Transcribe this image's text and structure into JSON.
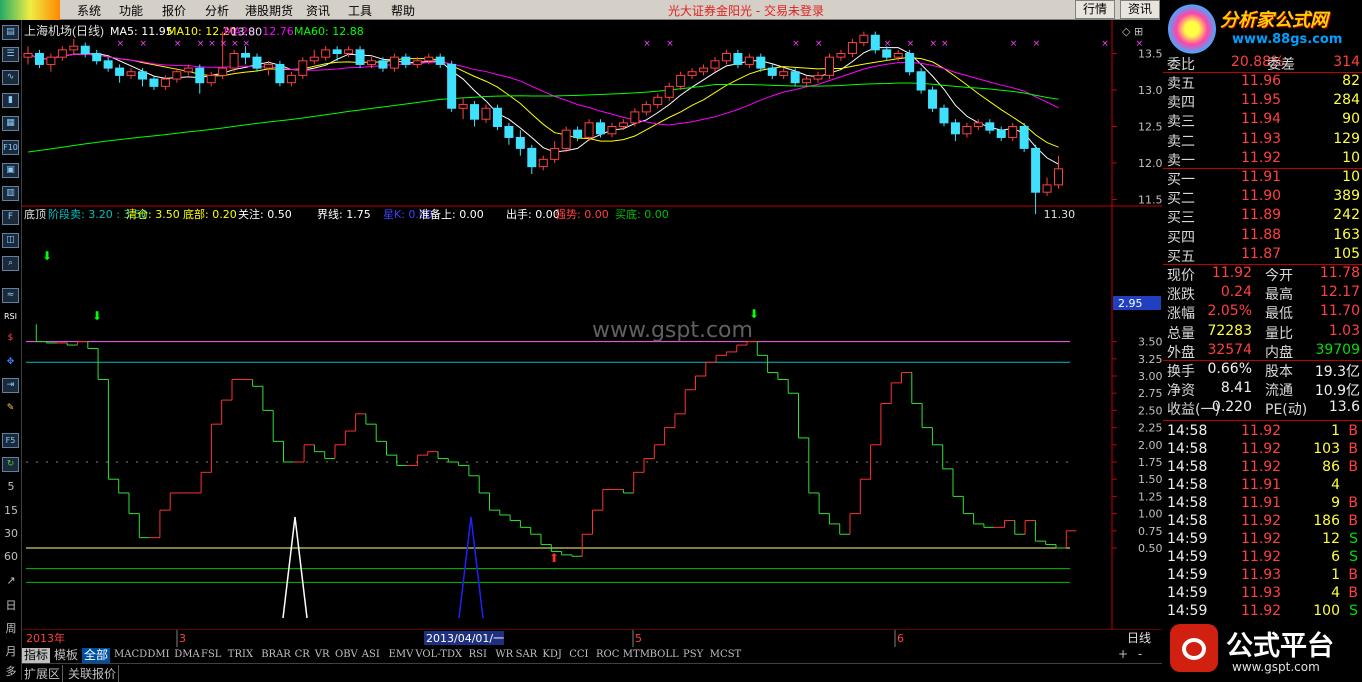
{
  "app": {
    "broker_notice": "光大证券金阳光 - 交易未登录"
  },
  "menu": [
    "系统",
    "功能",
    "报价",
    "分析",
    "港股期货",
    "资讯",
    "工具",
    "帮助"
  ],
  "top_buttons": [
    "行情",
    "资讯"
  ],
  "brand": {
    "name": "分析家公式网",
    "url": "www.88gs.com"
  },
  "brand2": {
    "name": "公式平台",
    "url": "www.gspt.com"
  },
  "watermark": "www.gspt.com",
  "toolbar_numbers": [
    "5",
    "15",
    "30",
    "60"
  ],
  "toolbar_labels": [
    "F10",
    "RSI",
    "F5",
    "日",
    "周",
    "月",
    "多"
  ],
  "main_chart": {
    "title": "上海机场(日线)",
    "ma": [
      {
        "label": "MA5: 11.95",
        "color": "#ffffff"
      },
      {
        "label": "MA10: 12.20",
        "color": "#ffff00"
      },
      {
        "label": "MA20: 12.76",
        "color": "#ff00ff"
      },
      {
        "label": "MA60: 12.88",
        "color": "#00ff00"
      }
    ],
    "high_label": "13.80",
    "low_label": "11.30",
    "yticks": [
      "13.50",
      "13.00",
      "12.50",
      "12.00",
      "11.50"
    ],
    "candles": [
      [
        13.45,
        13.5,
        13.6,
        13.35
      ],
      [
        13.5,
        13.35,
        13.55,
        13.3
      ],
      [
        13.35,
        13.45,
        13.5,
        13.25
      ],
      [
        13.45,
        13.55,
        13.6,
        13.4
      ],
      [
        13.55,
        13.6,
        13.7,
        13.5
      ],
      [
        13.6,
        13.5,
        13.65,
        13.45
      ],
      [
        13.5,
        13.4,
        13.55,
        13.35
      ],
      [
        13.4,
        13.3,
        13.45,
        13.25
      ],
      [
        13.3,
        13.2,
        13.35,
        13.1
      ],
      [
        13.2,
        13.25,
        13.3,
        13.15
      ],
      [
        13.25,
        13.15,
        13.3,
        13.05
      ],
      [
        13.15,
        13.05,
        13.2,
        13.0
      ],
      [
        13.05,
        13.15,
        13.2,
        13.0
      ],
      [
        13.15,
        13.25,
        13.3,
        13.1
      ],
      [
        13.25,
        13.3,
        13.35,
        13.2
      ],
      [
        13.3,
        13.1,
        13.35,
        12.95
      ],
      [
        13.1,
        13.2,
        13.25,
        13.05
      ],
      [
        13.2,
        13.3,
        13.8,
        13.15
      ],
      [
        13.3,
        13.5,
        13.55,
        13.25
      ],
      [
        13.5,
        13.45,
        13.6,
        13.35
      ],
      [
        13.45,
        13.3,
        13.5,
        13.25
      ],
      [
        13.3,
        13.35,
        13.4,
        13.2
      ],
      [
        13.35,
        13.1,
        13.4,
        13.05
      ],
      [
        13.1,
        13.2,
        13.25,
        13.05
      ],
      [
        13.2,
        13.4,
        13.45,
        13.15
      ],
      [
        13.4,
        13.45,
        13.55,
        13.35
      ],
      [
        13.45,
        13.55,
        13.6,
        13.4
      ],
      [
        13.55,
        13.5,
        13.6,
        13.4
      ],
      [
        13.5,
        13.55,
        13.6,
        13.45
      ],
      [
        13.55,
        13.35,
        13.6,
        13.3
      ],
      [
        13.35,
        13.4,
        13.45,
        13.3
      ],
      [
        13.4,
        13.3,
        13.45,
        13.25
      ],
      [
        13.3,
        13.45,
        13.5,
        13.25
      ],
      [
        13.45,
        13.35,
        13.5,
        13.3
      ],
      [
        13.35,
        13.4,
        13.45,
        13.3
      ],
      [
        13.4,
        13.45,
        13.5,
        13.35
      ],
      [
        13.45,
        13.35,
        13.5,
        13.3
      ],
      [
        13.35,
        12.75,
        13.4,
        12.7
      ],
      [
        12.75,
        12.8,
        12.9,
        12.6
      ],
      [
        12.8,
        12.6,
        12.85,
        12.5
      ],
      [
        12.6,
        12.75,
        12.8,
        12.55
      ],
      [
        12.75,
        12.5,
        12.8,
        12.45
      ],
      [
        12.5,
        12.35,
        12.55,
        12.25
      ],
      [
        12.35,
        12.2,
        12.45,
        12.1
      ],
      [
        12.2,
        11.95,
        12.25,
        11.85
      ],
      [
        11.95,
        12.05,
        12.1,
        11.9
      ],
      [
        12.05,
        12.2,
        12.3,
        12.0
      ],
      [
        12.2,
        12.45,
        12.5,
        12.15
      ],
      [
        12.45,
        12.35,
        12.5,
        12.3
      ],
      [
        12.35,
        12.55,
        12.6,
        12.3
      ],
      [
        12.55,
        12.4,
        12.6,
        12.35
      ],
      [
        12.4,
        12.5,
        12.55,
        12.35
      ],
      [
        12.5,
        12.55,
        12.6,
        12.45
      ],
      [
        12.55,
        12.7,
        12.75,
        12.5
      ],
      [
        12.7,
        12.8,
        12.85,
        12.65
      ],
      [
        12.8,
        12.9,
        12.95,
        12.75
      ],
      [
        12.9,
        13.05,
        13.1,
        12.85
      ],
      [
        13.05,
        13.2,
        13.25,
        13.0
      ],
      [
        13.2,
        13.25,
        13.3,
        13.15
      ],
      [
        13.25,
        13.3,
        13.35,
        13.2
      ],
      [
        13.3,
        13.4,
        13.45,
        13.25
      ],
      [
        13.4,
        13.5,
        13.55,
        13.35
      ],
      [
        13.5,
        13.35,
        13.55,
        13.3
      ],
      [
        13.35,
        13.45,
        13.5,
        13.3
      ],
      [
        13.45,
        13.3,
        13.5,
        13.25
      ],
      [
        13.3,
        13.2,
        13.35,
        13.15
      ],
      [
        13.2,
        13.25,
        13.3,
        13.15
      ],
      [
        13.25,
        13.1,
        13.3,
        13.05
      ],
      [
        13.1,
        13.15,
        13.2,
        13.05
      ],
      [
        13.15,
        13.2,
        13.25,
        13.1
      ],
      [
        13.2,
        13.45,
        13.5,
        13.15
      ],
      [
        13.45,
        13.5,
        13.55,
        13.4
      ],
      [
        13.5,
        13.65,
        13.7,
        13.45
      ],
      [
        13.65,
        13.75,
        13.8,
        13.6
      ],
      [
        13.75,
        13.55,
        13.8,
        13.5
      ],
      [
        13.55,
        13.45,
        13.6,
        13.4
      ],
      [
        13.45,
        13.5,
        13.55,
        13.4
      ],
      [
        13.5,
        13.25,
        13.55,
        13.2
      ],
      [
        13.25,
        13.0,
        13.3,
        12.95
      ],
      [
        13.0,
        12.75,
        13.05,
        12.7
      ],
      [
        12.75,
        12.55,
        12.8,
        12.5
      ],
      [
        12.55,
        12.4,
        12.6,
        12.3
      ],
      [
        12.4,
        12.5,
        12.55,
        12.35
      ],
      [
        12.5,
        12.55,
        12.6,
        12.45
      ],
      [
        12.55,
        12.45,
        12.6,
        12.4
      ],
      [
        12.45,
        12.35,
        12.5,
        12.3
      ],
      [
        12.35,
        12.5,
        12.55,
        12.3
      ],
      [
        12.5,
        12.2,
        12.55,
        12.15
      ],
      [
        12.2,
        11.6,
        12.25,
        11.3
      ],
      [
        11.6,
        11.7,
        11.8,
        11.55
      ],
      [
        11.7,
        11.92,
        12.1,
        11.65
      ]
    ]
  },
  "indicator": {
    "title": "底顶",
    "items": [
      {
        "label": "阶段卖: 3.20 : 3.50",
        "color": "#00c0c0"
      },
      {
        "label": "清仓: 3.50",
        "color": "#ffff00"
      },
      {
        "label": "底部: 0.20",
        "color": "#ffff00"
      },
      {
        "label": "关注: 0.50",
        "color": "#ffffff"
      },
      {
        "label": "界线: 1.75",
        "color": "#ffffff"
      },
      {
        "label": "星K: 0.00",
        "color": "#4040ff"
      },
      {
        "label": "准备上: 0.00",
        "color": "#ffffff"
      },
      {
        "label": "出手: 0.00",
        "color": "#ffffff"
      },
      {
        "label": "强势: 0.00",
        "color": "#ff4040"
      },
      {
        "label": "买底: 0.00",
        "color": "#00c000"
      }
    ],
    "yticks": [
      "3.50",
      "3.25",
      "3.00",
      "2.75",
      "2.50",
      "2.25",
      "2.00",
      "1.75",
      "1.50",
      "1.25",
      "1.00",
      "0.75",
      "0.50"
    ],
    "current_value": "2.95",
    "hlines": [
      {
        "v": 3.5,
        "color": "#ff60ff"
      },
      {
        "v": 3.2,
        "color": "#00c0c0"
      },
      {
        "v": 1.75,
        "color": "#808080"
      },
      {
        "v": 0.5,
        "color": "#ffff80"
      },
      {
        "v": 0.2,
        "color": "#00c000"
      },
      {
        "v": 0.0,
        "color": "#00c000"
      }
    ],
    "steps": [
      3.75,
      3.5,
      3.48,
      3.48,
      3.45,
      3.5,
      3.4,
      2.95,
      1.5,
      1.3,
      1.0,
      0.65,
      0.65,
      1.05,
      1.3,
      1.3,
      1.3,
      1.6,
      2.3,
      2.65,
      2.95,
      2.95,
      2.85,
      2.5,
      2.05,
      1.75,
      1.75,
      2.0,
      1.9,
      1.8,
      2.0,
      2.2,
      2.45,
      2.3,
      2.05,
      1.85,
      1.7,
      1.7,
      1.85,
      1.9,
      1.8,
      1.75,
      1.7,
      1.55,
      1.3,
      1.05,
      0.98,
      0.9,
      0.8,
      0.7,
      0.55,
      0.45,
      0.4,
      0.38,
      0.7,
      1.05,
      1.35,
      1.35,
      1.3,
      1.6,
      1.8,
      2.0,
      2.25,
      2.45,
      2.8,
      3.0,
      3.2,
      3.3,
      3.35,
      3.45,
      3.5,
      3.3,
      3.05,
      2.95,
      2.75,
      2.1,
      1.3,
      1.0,
      0.85,
      0.7,
      1.0,
      1.5,
      2.0,
      2.6,
      2.9,
      3.05,
      2.6,
      2.25,
      2.0,
      1.65,
      1.25,
      1.0,
      0.85,
      0.8,
      0.8,
      0.9,
      0.7,
      0.9,
      0.6,
      0.55,
      0.5,
      0.75
    ],
    "peaks": [
      {
        "x": 273,
        "color": "#ffffff"
      },
      {
        "x": 449,
        "color": "#2020ff"
      }
    ]
  },
  "timeline": {
    "labels": [
      "2013年",
      "3",
      "2013/04/01/一",
      "5",
      "6"
    ],
    "period": "日线"
  },
  "tabs": [
    "指标",
    "模板",
    "全部",
    "MACD",
    "DMI",
    "DMA",
    "FSL",
    "TRIX",
    "BRAR",
    "CR",
    "VR",
    "OBV",
    "ASI",
    "EMV",
    "VOL-TDX",
    "RSI",
    "WR",
    "SAR",
    "KDJ",
    "CCI",
    "ROC",
    "MTM",
    "BOLL",
    "PSY",
    "MCST"
  ],
  "bottom_bar": [
    "扩展区",
    "关联报价"
  ],
  "zoom": [
    "+",
    "-"
  ],
  "quote": {
    "header": {
      "label": "委比",
      "value": "20.88%",
      "label2": "委差",
      "value2": "314"
    },
    "sell": [
      {
        "label": "卖五",
        "price": "11.96",
        "vol": "82"
      },
      {
        "label": "卖四",
        "price": "11.95",
        "vol": "284"
      },
      {
        "label": "卖三",
        "price": "11.94",
        "vol": "90"
      },
      {
        "label": "卖二",
        "price": "11.93",
        "vol": "129"
      },
      {
        "label": "卖一",
        "price": "11.92",
        "vol": "10"
      }
    ],
    "buy": [
      {
        "label": "买一",
        "price": "11.91",
        "vol": "10"
      },
      {
        "label": "买二",
        "price": "11.90",
        "vol": "389"
      },
      {
        "label": "买三",
        "price": "11.89",
        "vol": "242"
      },
      {
        "label": "买四",
        "price": "11.88",
        "vol": "163"
      },
      {
        "label": "买五",
        "price": "11.87",
        "vol": "105"
      }
    ],
    "stats": [
      {
        "l1": "现价",
        "v1": "11.92",
        "c1": "red",
        "l2": "今开",
        "v2": "11.78",
        "c2": "red"
      },
      {
        "l1": "涨跌",
        "v1": "0.24",
        "c1": "red",
        "l2": "最高",
        "v2": "12.17",
        "c2": "red"
      },
      {
        "l1": "涨幅",
        "v1": "2.05%",
        "c1": "red",
        "l2": "最低",
        "v2": "11.70",
        "c2": "red"
      },
      {
        "l1": "总量",
        "v1": "72283",
        "c1": "yel",
        "l2": "量比",
        "v2": "1.03",
        "c2": "red"
      },
      {
        "l1": "外盘",
        "v1": "32574",
        "c1": "red",
        "l2": "内盘",
        "v2": "39709",
        "c2": "grn"
      }
    ],
    "stats2": [
      {
        "l1": "换手",
        "v1": "0.66%",
        "l2": "股本",
        "v2": "19.3亿"
      },
      {
        "l1": "净资",
        "v1": "8.41",
        "l2": "流通",
        "v2": "10.9亿"
      },
      {
        "l1": "收益(一)",
        "v1": "0.220",
        "l2": "PE(动)",
        "v2": "13.6"
      }
    ],
    "ticks": [
      {
        "t": "14:58",
        "p": "11.92",
        "v": "1",
        "s": "B"
      },
      {
        "t": "14:58",
        "p": "11.92",
        "v": "103",
        "s": "B"
      },
      {
        "t": "14:58",
        "p": "11.92",
        "v": "86",
        "s": "B"
      },
      {
        "t": "14:58",
        "p": "11.91",
        "v": "4",
        "s": ""
      },
      {
        "t": "14:58",
        "p": "11.91",
        "v": "9",
        "s": "B"
      },
      {
        "t": "14:58",
        "p": "11.92",
        "v": "186",
        "s": "B"
      },
      {
        "t": "14:59",
        "p": "11.92",
        "v": "12",
        "s": "S"
      },
      {
        "t": "14:59",
        "p": "11.92",
        "v": "6",
        "s": "S"
      },
      {
        "t": "14:59",
        "p": "11.93",
        "v": "1",
        "s": "B"
      },
      {
        "t": "14:59",
        "p": "11.93",
        "v": "4",
        "s": "B"
      },
      {
        "t": "14:59",
        "p": "11.92",
        "v": "100",
        "s": "S"
      }
    ]
  }
}
